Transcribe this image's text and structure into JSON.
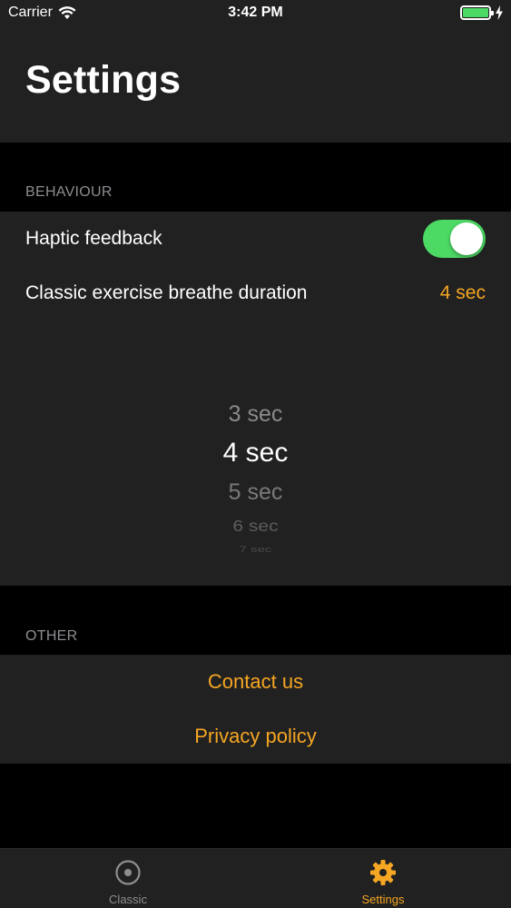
{
  "status_bar": {
    "carrier": "Carrier",
    "time": "3:42 PM",
    "battery_color": "#4cd964"
  },
  "header": {
    "title": "Settings"
  },
  "sections": {
    "behaviour": {
      "header": "BEHAVIOUR",
      "haptic_label": "Haptic feedback",
      "haptic_on": true,
      "duration_label": "Classic exercise breathe duration",
      "duration_value": "4 sec",
      "picker_options": [
        "3 sec",
        "4 sec",
        "5 sec",
        "6 sec",
        "7 sec"
      ],
      "picker_selected": "4 sec"
    },
    "other": {
      "header": "OTHER",
      "contact_label": "Contact us",
      "privacy_label": "Privacy policy"
    }
  },
  "tab_bar": {
    "tabs": [
      {
        "label": "Classic",
        "icon": "target-circle-icon",
        "active": false
      },
      {
        "label": "Settings",
        "icon": "gear-icon",
        "active": true
      }
    ]
  },
  "colors": {
    "accent": "#f5a623",
    "toggle_on": "#4cd964",
    "inactive_tab": "#8e8e93"
  }
}
